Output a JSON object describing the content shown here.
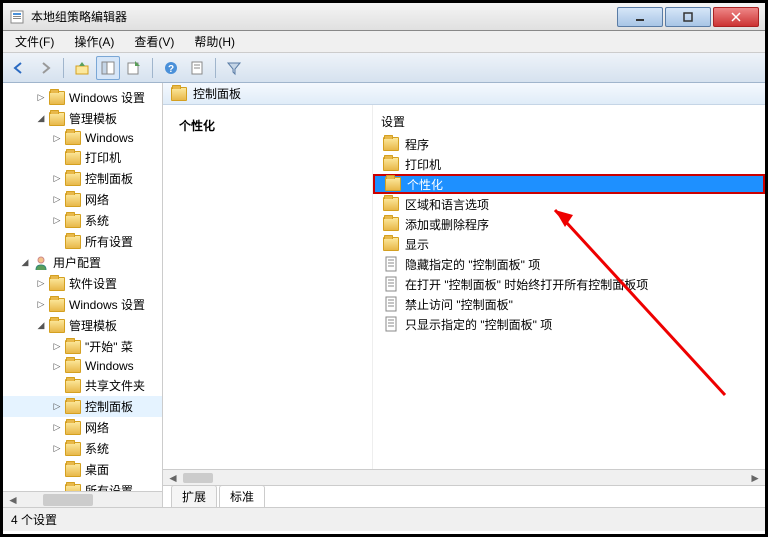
{
  "window": {
    "title": "本地组策略编辑器"
  },
  "menu": {
    "file": "文件(F)",
    "action": "操作(A)",
    "view": "查看(V)",
    "help": "帮助(H)"
  },
  "tree": {
    "items": [
      {
        "indent": 2,
        "toggle": "▷",
        "type": "folder",
        "label": "Windows 设置"
      },
      {
        "indent": 2,
        "toggle": "◢",
        "type": "folder",
        "label": "管理模板"
      },
      {
        "indent": 3,
        "toggle": "▷",
        "type": "folder",
        "label": "Windows"
      },
      {
        "indent": 3,
        "toggle": "",
        "type": "folder",
        "label": "打印机"
      },
      {
        "indent": 3,
        "toggle": "▷",
        "type": "folder",
        "label": "控制面板"
      },
      {
        "indent": 3,
        "toggle": "▷",
        "type": "folder",
        "label": "网络"
      },
      {
        "indent": 3,
        "toggle": "▷",
        "type": "folder",
        "label": "系统"
      },
      {
        "indent": 3,
        "toggle": "",
        "type": "folder",
        "label": "所有设置"
      },
      {
        "indent": 1,
        "toggle": "◢",
        "type": "user",
        "label": "用户配置"
      },
      {
        "indent": 2,
        "toggle": "▷",
        "type": "folder",
        "label": "软件设置"
      },
      {
        "indent": 2,
        "toggle": "▷",
        "type": "folder",
        "label": "Windows 设置"
      },
      {
        "indent": 2,
        "toggle": "◢",
        "type": "folder",
        "label": "管理模板"
      },
      {
        "indent": 3,
        "toggle": "▷",
        "type": "folder",
        "label": "\"开始\" 菜"
      },
      {
        "indent": 3,
        "toggle": "▷",
        "type": "folder",
        "label": "Windows"
      },
      {
        "indent": 3,
        "toggle": "",
        "type": "folder",
        "label": "共享文件夹"
      },
      {
        "indent": 3,
        "toggle": "▷",
        "type": "folder",
        "label": "控制面板",
        "selected": true
      },
      {
        "indent": 3,
        "toggle": "▷",
        "type": "folder",
        "label": "网络"
      },
      {
        "indent": 3,
        "toggle": "▷",
        "type": "folder",
        "label": "系统"
      },
      {
        "indent": 3,
        "toggle": "",
        "type": "folder",
        "label": "桌面"
      },
      {
        "indent": 3,
        "toggle": "",
        "type": "folder",
        "label": "所有设置"
      }
    ]
  },
  "breadcrumb": "控制面板",
  "left_column": {
    "title": "个性化"
  },
  "right_column": {
    "header": "设置",
    "items": [
      {
        "type": "folder",
        "label": "程序"
      },
      {
        "type": "folder",
        "label": "打印机"
      },
      {
        "type": "folder",
        "label": "个性化",
        "highlighted": true
      },
      {
        "type": "folder",
        "label": "区域和语言选项"
      },
      {
        "type": "folder",
        "label": "添加或删除程序"
      },
      {
        "type": "folder",
        "label": "显示"
      },
      {
        "type": "policy",
        "label": "隐藏指定的 \"控制面板\" 项"
      },
      {
        "type": "policy",
        "label": "在打开 \"控制面板\" 时始终打开所有控制面板项"
      },
      {
        "type": "policy",
        "label": "禁止访问 \"控制面板\""
      },
      {
        "type": "policy",
        "label": "只显示指定的 \"控制面板\" 项"
      }
    ]
  },
  "tabs": {
    "extended": "扩展",
    "standard": "标准"
  },
  "status": "4 个设置"
}
